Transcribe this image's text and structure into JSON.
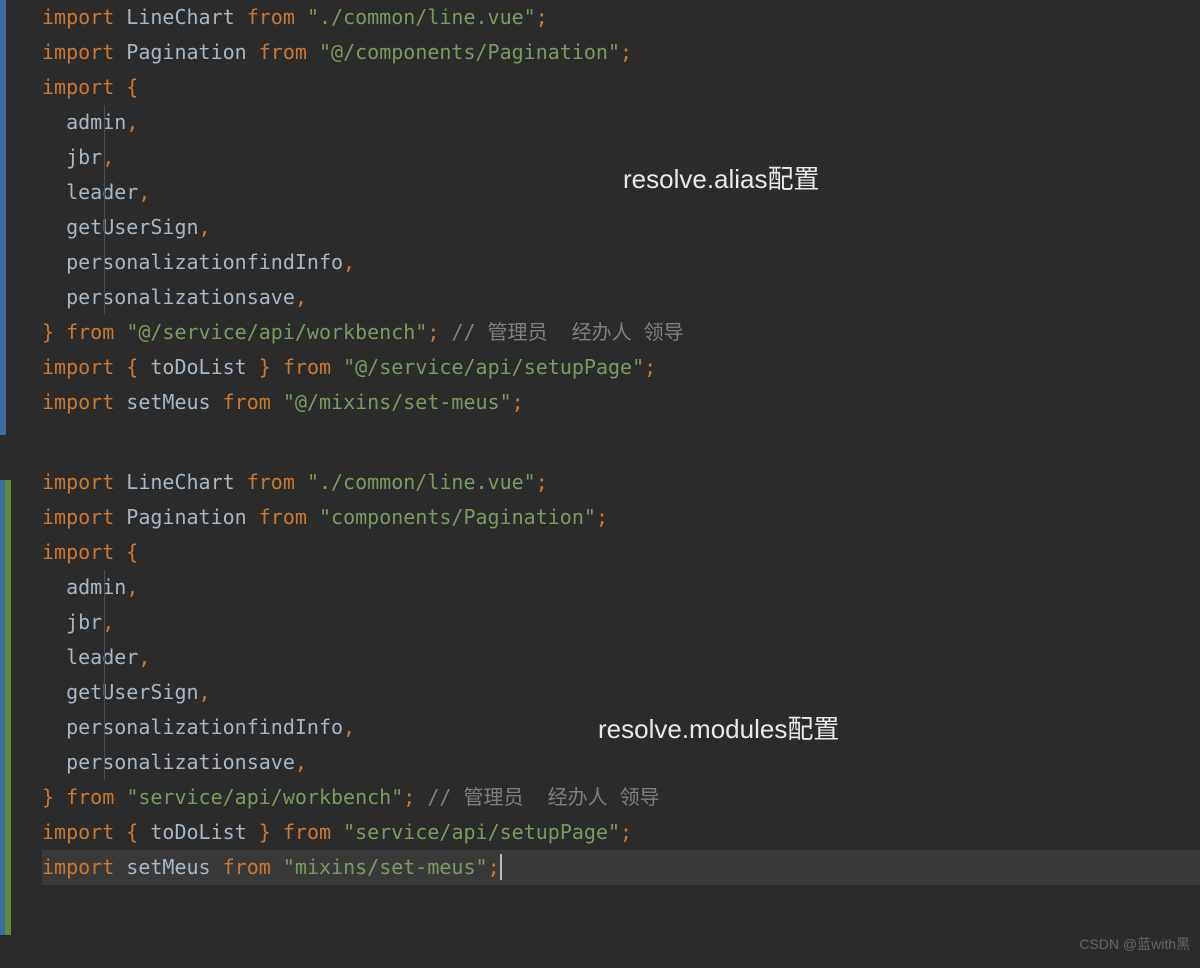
{
  "tokens": {
    "import": "import",
    "from": "from",
    "lbrace": "{",
    "rbrace": "}",
    "comma": ",",
    "semi": ";"
  },
  "block1": {
    "annotation": "resolve.alias配置",
    "lineChart": {
      "ident": "LineChart",
      "path": "\"./common/line.vue\""
    },
    "pagination": {
      "ident": "Pagination",
      "path": "\"@/components/Pagination\""
    },
    "named": [
      "admin",
      "jbr",
      "leader",
      "getUserSign",
      "personalizationfindInfo",
      "personalizationsave"
    ],
    "namedFrom": "\"@/service/api/workbench\"",
    "namedComment": "// 管理员  经办人 领导",
    "toDoList": {
      "ident": "toDoList",
      "path": "\"@/service/api/setupPage\""
    },
    "setMeus": {
      "ident": "setMeus",
      "path": "\"@/mixins/set-meus\""
    }
  },
  "block2": {
    "annotation": "resolve.modules配置",
    "lineChart": {
      "ident": "LineChart",
      "path": "\"./common/line.vue\""
    },
    "pagination": {
      "ident": "Pagination",
      "path": "\"components/Pagination\""
    },
    "named": [
      "admin",
      "jbr",
      "leader",
      "getUserSign",
      "personalizationfindInfo",
      "personalizationsave"
    ],
    "namedFrom": "\"service/api/workbench\"",
    "namedComment": "// 管理员  经办人 领导",
    "toDoList": {
      "ident": "toDoList",
      "path": "\"service/api/setupPage\""
    },
    "setMeus": {
      "ident": "setMeus",
      "path": "\"mixins/set-meus\""
    }
  },
  "watermark": "CSDN @蓝with黑"
}
